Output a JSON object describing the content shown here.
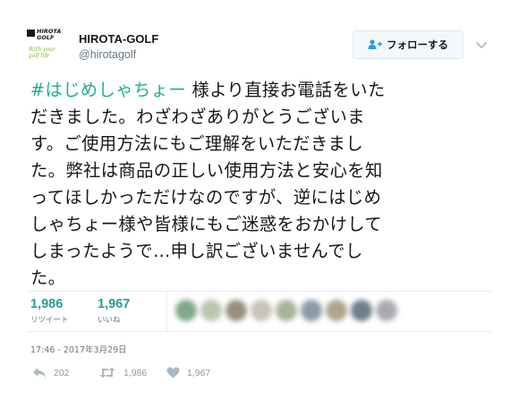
{
  "author": {
    "logo_text": "HIROTA GOLF",
    "logo_tagline": "With your golf life",
    "name": "HIROTA-GOLF",
    "handle": "@hirotagolf"
  },
  "follow_button": {
    "label": "フォローする",
    "icon": "add-user-icon"
  },
  "more_menu_icon": "chevron-down-icon",
  "tweet": {
    "hashtag": "#はじめしゃちょー",
    "lines": [
      " 様より直接お電話をいた",
      "だきました。わざわざありがとうございま",
      "す。ご使用方法にもご理解をいただきまし",
      "た。弊社は商品の正しい使用方法と安心を知",
      "ってほしかっただけなのですが、逆にはじめ",
      "しゃちょー様や皆様にもご迷惑をおかけして",
      "しまったようで…申し訳ございませんでし",
      "た。"
    ]
  },
  "stats": {
    "retweets": {
      "count": "1,986",
      "label": "リツイート"
    },
    "likes": {
      "count": "1,967",
      "label": "いいね"
    }
  },
  "timestamp": "17:46 - 2017年3月29日",
  "actions": {
    "reply": {
      "icon": "reply-icon",
      "count": "202"
    },
    "retweet": {
      "icon": "retweet-icon",
      "count": "1,986"
    },
    "like": {
      "icon": "heart-icon",
      "count": "1,967"
    }
  },
  "colors": {
    "accent": "#2a9b8f",
    "hashtag": "#20b08f",
    "text": "#14171a",
    "muted": "#657786",
    "border": "#e6ecf0"
  }
}
